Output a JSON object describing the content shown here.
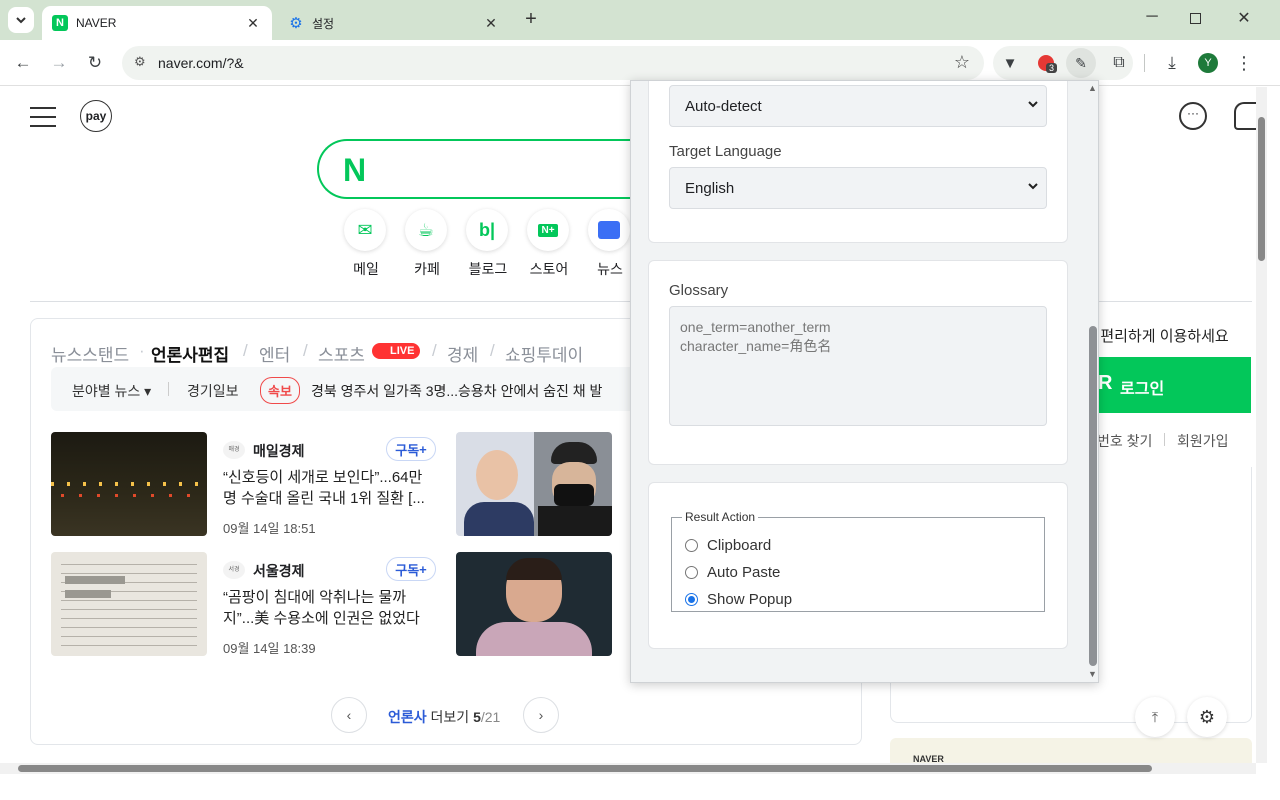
{
  "browser": {
    "tabs": [
      {
        "title": "NAVER",
        "active": true
      },
      {
        "title": "설정",
        "active": false
      }
    ],
    "address": "naver.com/?&",
    "profile_initial": "Y",
    "extension_badge": "3"
  },
  "naver": {
    "services": [
      {
        "label": "메일",
        "icon": "mail-icon"
      },
      {
        "label": "카페",
        "icon": "cafe-icon"
      },
      {
        "label": "블로그",
        "icon": "blog-icon"
      },
      {
        "label": "스토어",
        "icon": "store-icon"
      },
      {
        "label": "뉴스",
        "icon": "news-icon"
      }
    ],
    "news_tabs": [
      "뉴스스탠드",
      "언론사편집",
      "엔터",
      "스포츠",
      "경제",
      "쇼핑투데이"
    ],
    "live_badge": "LIVE",
    "ticker": {
      "category": "분야별 뉴스",
      "press": "경기일보",
      "badge": "속보",
      "headline": "경북 영주서 일가족 3명...승용차 안에서 숨진 채 발"
    },
    "articles": [
      {
        "press": "매일경제",
        "subscribe": "구독",
        "headline": "“신호등이 세개로 보인다”...64만명 수술대 올린 국내 1위 질환 [...",
        "date": "09월 14일 18:51"
      },
      {
        "press": "서울경제",
        "subscribe": "구독",
        "headline": "“곰팡이 침대에 악취나는 물까지”...美 수용소에 인권은 없었다",
        "date": "09월 14일 18:39"
      }
    ],
    "pager": {
      "label": "언론사",
      "more": "더보기",
      "current": "5",
      "total": "/21"
    },
    "login_hint": ". 편리하게 이용하세요",
    "login_button": "로그인",
    "find_password": "번호 찾기",
    "signup": "회원가입",
    "ad_label": "NAVER"
  },
  "popup": {
    "source_language": "Auto-detect",
    "target_language_label": "Target Language",
    "target_language": "English",
    "glossary_label": "Glossary",
    "glossary_placeholder": "one_term=another_term\ncharacter_name=角色名",
    "result_action_label": "Result Action",
    "result_actions": [
      {
        "label": "Clipboard",
        "checked": false
      },
      {
        "label": "Auto Paste",
        "checked": false
      },
      {
        "label": "Show Popup",
        "checked": true
      }
    ]
  },
  "colors": {
    "tab_strip": "#d3e3d1",
    "naver_green": "#03c75a",
    "radio_accent": "#1a73e8"
  }
}
